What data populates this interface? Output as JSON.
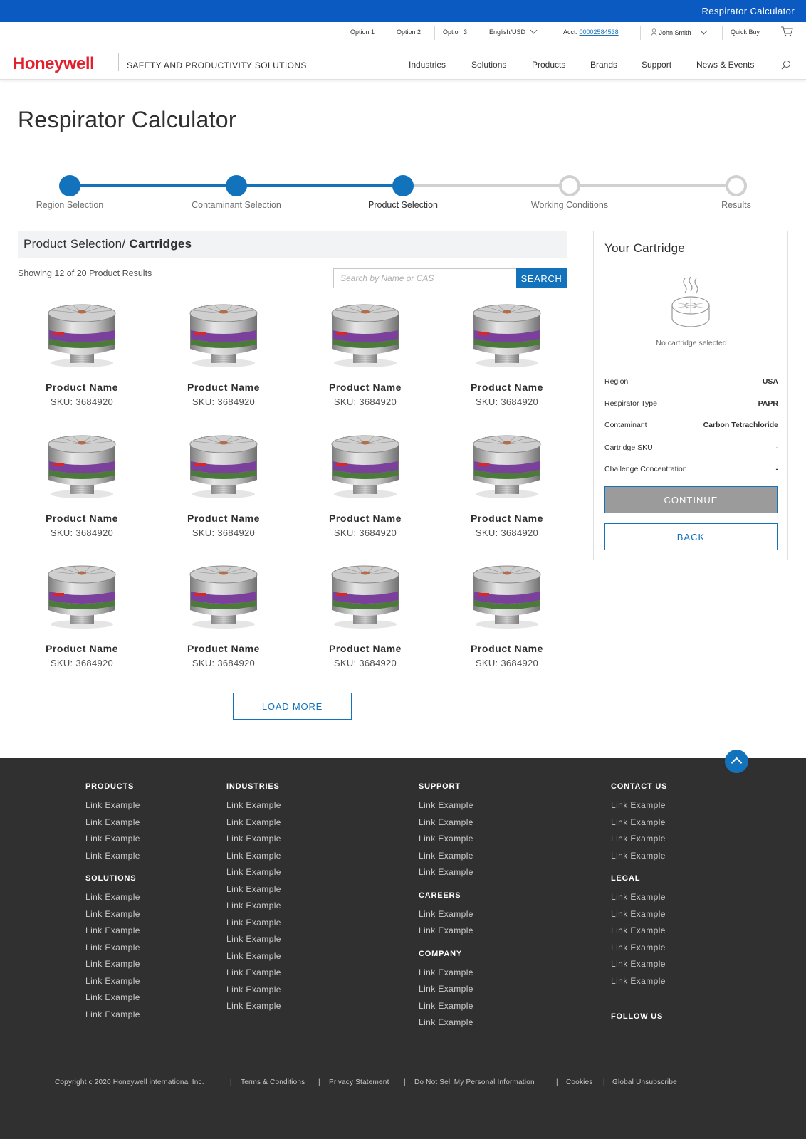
{
  "topbar": {
    "title": "Respirator Calculator"
  },
  "utility": {
    "options": [
      "Option 1",
      "Option 2",
      "Option 3"
    ],
    "language": "English/USD",
    "acct_label": "Acct:",
    "acct_number": "00002584538",
    "user": "John Smith",
    "quick_buy": "Quick Buy"
  },
  "header": {
    "logo": "Honeywell",
    "tagline": "SAFETY AND PRODUCTIVITY SOLUTIONS",
    "nav": [
      "Industries",
      "Solutions",
      "Products",
      "Brands",
      "Support",
      "News & Events"
    ]
  },
  "page": {
    "title": "Respirator Calculator"
  },
  "stepper": {
    "steps": [
      {
        "label": "Region Selection",
        "state": "done"
      },
      {
        "label": "Contaminant Selection",
        "state": "done"
      },
      {
        "label": "Product Selection",
        "state": "current"
      },
      {
        "label": "Working Conditions",
        "state": "todo"
      },
      {
        "label": "Results",
        "state": "todo"
      }
    ],
    "colors": {
      "done": "#1273bc",
      "todo": "#d0d0d0"
    }
  },
  "section": {
    "title_prefix": "Product Selection/ ",
    "title_bold": "Cartridges"
  },
  "results": {
    "count_text": "Showing 12 of 20 Product Results"
  },
  "search": {
    "placeholder": "Search by Name or CAS",
    "value": "",
    "button": "SEARCH"
  },
  "products": [
    {
      "name": "Product Name",
      "sku": "SKU: 3684920"
    },
    {
      "name": "Product Name",
      "sku": "SKU: 3684920"
    },
    {
      "name": "Product Name",
      "sku": "SKU: 3684920"
    },
    {
      "name": "Product Name",
      "sku": "SKU: 3684920"
    },
    {
      "name": "Product Name",
      "sku": "SKU: 3684920"
    },
    {
      "name": "Product Name",
      "sku": "SKU: 3684920"
    },
    {
      "name": "Product Name",
      "sku": "SKU: 3684920"
    },
    {
      "name": "Product Name",
      "sku": "SKU: 3684920"
    },
    {
      "name": "Product Name",
      "sku": "SKU: 3684920"
    },
    {
      "name": "Product Name",
      "sku": "SKU: 3684920"
    },
    {
      "name": "Product Name",
      "sku": "SKU: 3684920"
    },
    {
      "name": "Product Name",
      "sku": "SKU: 3684920"
    }
  ],
  "load_more": "LOAD MORE",
  "cartridge": {
    "title": "Your Cartridge",
    "empty_text": "No cartridge selected",
    "rows": [
      {
        "label": "Region",
        "value": "USA"
      },
      {
        "label": "Respirator Type",
        "value": "PAPR"
      },
      {
        "label": "Contaminant",
        "value": "Carbon Tetrachloride"
      },
      {
        "label": "Cartridge SKU",
        "value": "-"
      },
      {
        "label": "Challenge Concentration",
        "value": "-"
      }
    ],
    "continue": "CONTINUE",
    "back": "BACK"
  },
  "footer": {
    "columns": [
      {
        "groups": [
          {
            "heading": "PRODUCTS",
            "links": [
              "Link Example",
              "Link Example",
              "Link Example",
              "Link Example"
            ]
          },
          {
            "heading": "SOLUTIONS",
            "links": [
              "Link Example",
              "Link Example",
              "Link Example",
              "Link Example",
              "Link Example",
              "Link Example",
              "Link Example",
              "Link Example"
            ]
          }
        ]
      },
      {
        "groups": [
          {
            "heading": "INDUSTRIES",
            "links": [
              "Link Example",
              "Link Example",
              "Link Example",
              "Link Example",
              "Link Example",
              "Link Example",
              "Link Example",
              "Link Example",
              "Link Example",
              "Link Example",
              "Link Example",
              "Link Example",
              "Link Example"
            ]
          }
        ]
      },
      {
        "groups": [
          {
            "heading": "SUPPORT",
            "links": [
              "Link Example",
              "Link Example",
              "Link Example",
              "Link Example",
              "Link Example"
            ]
          },
          {
            "heading": "CAREERS",
            "links": [
              "Link Example",
              "Link Example"
            ]
          },
          {
            "heading": "COMPANY",
            "links": [
              "Link Example",
              "Link Example",
              "Link Example",
              "Link Example"
            ]
          }
        ]
      },
      {
        "groups": [
          {
            "heading": "CONTACT US",
            "links": [
              "Link Example",
              "Link Example",
              "Link Example",
              "Link Example"
            ]
          },
          {
            "heading": "LEGAL",
            "links": [
              "Link Example",
              "Link Example",
              "Link Example",
              "Link Example",
              "Link Example",
              "Link Example"
            ]
          },
          {
            "heading": "FOLLOW US",
            "links": []
          }
        ]
      }
    ],
    "legal": [
      "Copyright c  2020 Honeywell international Inc.",
      "|",
      "Terms & Conditions",
      "|",
      "Privacy Statement",
      "|",
      "Do Not Sell My Personal Information",
      "|",
      "Cookies",
      "|",
      "Global Unsubscribe"
    ]
  }
}
